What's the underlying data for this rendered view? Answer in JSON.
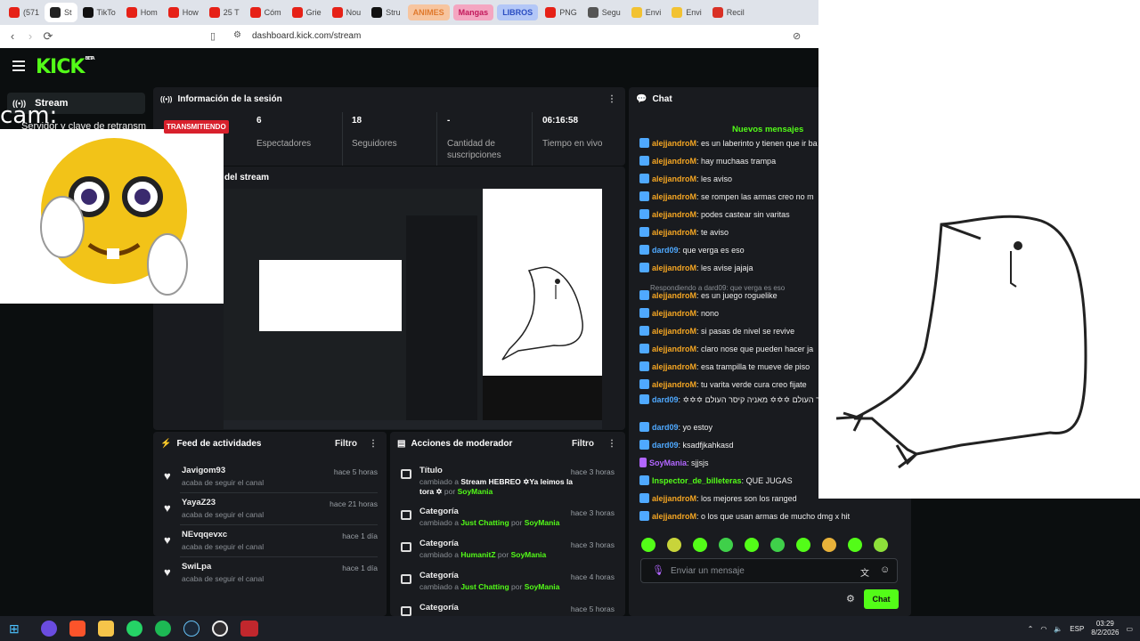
{
  "browser": {
    "tabs": [
      {
        "label": "(571",
        "color": "#e62117"
      },
      {
        "label": "St",
        "color": "#222"
      },
      {
        "label": "TikTo",
        "color": "#111"
      },
      {
        "label": "Hom",
        "color": "#e62117"
      },
      {
        "label": "How",
        "color": "#e62117"
      },
      {
        "label": "25 T",
        "color": "#e62117"
      },
      {
        "label": "Cóm",
        "color": "#e62117"
      },
      {
        "label": "Grie",
        "color": "#e62117"
      },
      {
        "label": "Nou",
        "color": "#e62117"
      },
      {
        "label": "Stru",
        "color": "#111"
      },
      {
        "label": "ANIMES",
        "color": "#f7c59f",
        "pill": true,
        "text": "#e07a2e"
      },
      {
        "label": "Mangas",
        "color": "#f4a6c1",
        "pill": true,
        "text": "#c2185b"
      },
      {
        "label": "LIBROS",
        "color": "#b3c7f7",
        "pill": true,
        "text": "#2a4dc2"
      },
      {
        "label": "PNG",
        "color": "#e62117"
      },
      {
        "label": "Segu",
        "color": "#555"
      },
      {
        "label": "Envi",
        "color": "#f2c232"
      },
      {
        "label": "Envi",
        "color": "#f2c232"
      },
      {
        "label": "Recil",
        "color": "#d93025"
      }
    ],
    "url": "dashboard.kick.com/stream"
  },
  "app": {
    "logo": "KICK",
    "logo_sup": "BETA",
    "nav_stream": "Stream",
    "side_sub": "Servidor y clave de retransm",
    "cam_label": "cam:"
  },
  "session": {
    "title": "Información de la sesión",
    "live_badge": "TRANSMITIENDO",
    "stats": [
      {
        "value": "6",
        "label": "Espectadores"
      },
      {
        "value": "18",
        "label": "Seguidores"
      },
      {
        "value": "-",
        "label": "Cantidad de suscripciones"
      },
      {
        "value": "06:16:58",
        "label": "Tiempo en vivo"
      }
    ]
  },
  "preview": {
    "title": "del stream"
  },
  "feed": {
    "title": "Feed de actividades",
    "filter": "Filtro",
    "items": [
      {
        "name": "Javigom93",
        "sub": "acaba de seguir el canal",
        "time": "hace 5 horas"
      },
      {
        "name": "YayaZ23",
        "sub": "acaba de seguir el canal",
        "time": "hace 21 horas"
      },
      {
        "name": "NEvqqevxc",
        "sub": "acaba de seguir el canal",
        "time": "hace 1 día"
      },
      {
        "name": "SwiLpa",
        "sub": "acaba de seguir el canal",
        "time": "hace 1 día"
      }
    ]
  },
  "mod": {
    "title": "Acciones de moderador",
    "filter": "Filtro",
    "items": [
      {
        "name": "Título",
        "pre": "cambiado a",
        "value": "Stream HEBREO ✡Ya leimos la tora ✡",
        "by": "por",
        "user": "SoyMania",
        "time": "hace 3 horas"
      },
      {
        "name": "Categoría",
        "pre": "cambiado a",
        "value": "Just Chatting",
        "by": "por",
        "user": "SoyMania",
        "time": "hace 3 horas"
      },
      {
        "name": "Categoría",
        "pre": "cambiado a",
        "value": "HumanitZ",
        "by": "por",
        "user": "SoyMania",
        "time": "hace 3 horas"
      },
      {
        "name": "Categoría",
        "pre": "cambiado a",
        "value": "Just Chatting",
        "by": "por",
        "user": "SoyMania",
        "time": "hace 4 horas"
      },
      {
        "name": "Categoría",
        "pre": "",
        "value": "",
        "by": "",
        "user": "",
        "time": "hace 5 horas"
      }
    ]
  },
  "chat": {
    "title": "Chat",
    "new_messages": "Nuevos mensajes",
    "reply_note": "Respondiendo a dard09: que verga es eso",
    "messages": [
      {
        "user": "alejjandroM",
        "color": "#f5a623",
        "text": "es un laberinto y tienen que ir ba"
      },
      {
        "user": "alejjandroM",
        "color": "#f5a623",
        "text": "hay muchaas trampa"
      },
      {
        "user": "alejjandroM",
        "color": "#f5a623",
        "text": "les aviso"
      },
      {
        "user": "alejjandroM",
        "color": "#f5a623",
        "text": "se rompen las armas creo no m"
      },
      {
        "user": "alejjandroM",
        "color": "#f5a623",
        "text": "podes castear sin varitas"
      },
      {
        "user": "alejjandroM",
        "color": "#f5a623",
        "text": "te aviso"
      },
      {
        "user": "dard09",
        "color": "#4fa9ff",
        "text": "que verga es eso"
      },
      {
        "user": "alejjandroM",
        "color": "#f5a623",
        "text": "les avise jajaja"
      },
      {
        "user": "alejjandroM",
        "color": "#f5a623",
        "text": "es un juego roguelike"
      },
      {
        "user": "alejjandroM",
        "color": "#f5a623",
        "text": "nono"
      },
      {
        "user": "alejjandroM",
        "color": "#f5a623",
        "text": "si pasas de nivel se revive"
      },
      {
        "user": "alejjandroM",
        "color": "#f5a623",
        "text": "claro nose que pueden hacer ja"
      },
      {
        "user": "alejjandroM",
        "color": "#f5a623",
        "text": "esa trampilla te mueve de piso"
      },
      {
        "user": "alejjandroM",
        "color": "#f5a623",
        "text": "tu varita verde cura creo fijate"
      },
      {
        "user": "dard09",
        "color": "#4fa9ff",
        "text": "✡✡✡ מאניה קיסר העולם ✡✡✡ מאניה קיסר העולם ✡✡✡"
      },
      {
        "user": "dard09",
        "color": "#4fa9ff",
        "text": "yo estoy"
      },
      {
        "user": "dard09",
        "color": "#4fa9ff",
        "text": "ksadfjkahkasd"
      },
      {
        "user": "SoyMania",
        "color": "#b266ff",
        "text": "sjjsjs"
      },
      {
        "user": "Inspector_de_billeteras",
        "color": "#53fc18",
        "text": "QUE JUGAS"
      },
      {
        "user": "alejjandroM",
        "color": "#f5a623",
        "text": "los mejores son los ranged"
      },
      {
        "user": "alejjandroM",
        "color": "#f5a623",
        "text": "o los que usan armas de mucho dmg x hit"
      }
    ],
    "placeholder": "Enviar un mensaje",
    "send": "Chat"
  },
  "taskbar": {
    "lang": "ESP",
    "time": "03:29",
    "date": "8/2/2026"
  }
}
